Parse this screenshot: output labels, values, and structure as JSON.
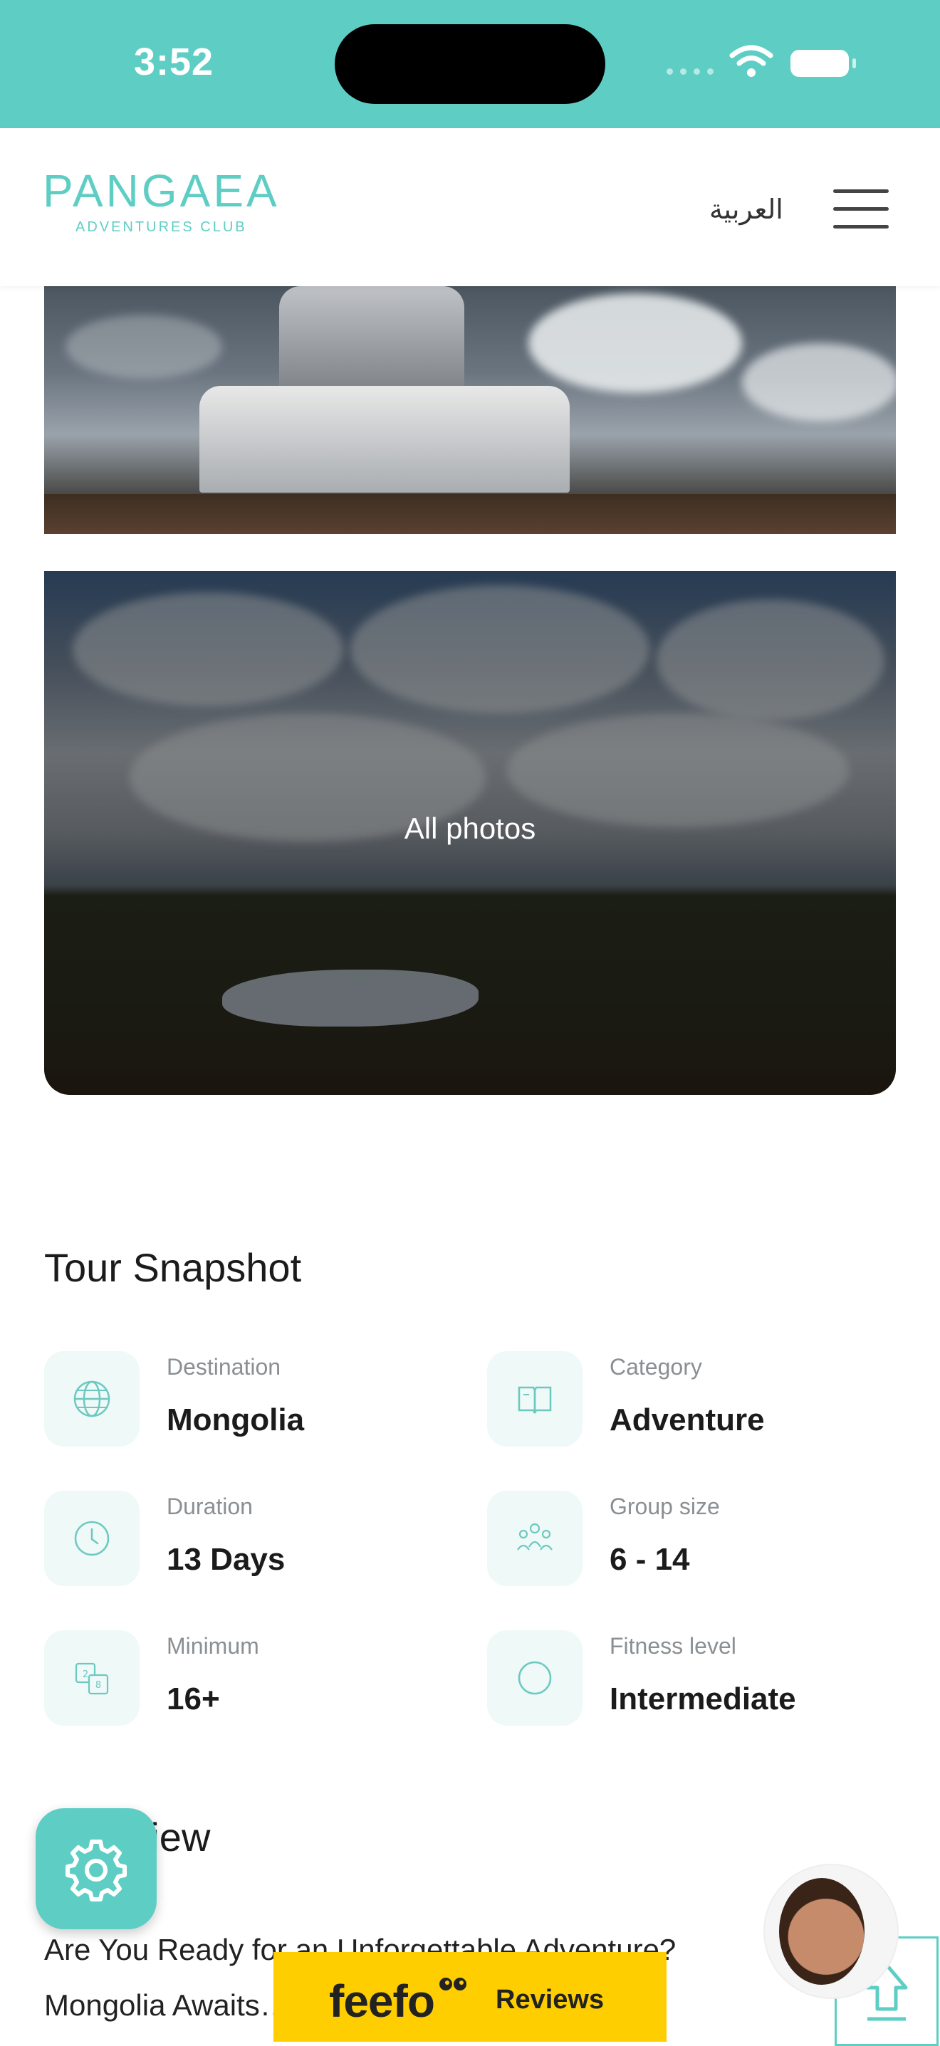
{
  "status_bar": {
    "time": "3:52"
  },
  "header": {
    "logo_text": "PANGAEA",
    "logo_subtext": "ADVENTURES CLUB",
    "language_link": "العربية"
  },
  "gallery": {
    "all_photos_label": "All photos"
  },
  "snapshot": {
    "title": "Tour Snapshot",
    "items": [
      {
        "label": "Destination",
        "value": "Mongolia",
        "icon": "globe-icon"
      },
      {
        "label": "Category",
        "value": "Adventure",
        "icon": "book-icon"
      },
      {
        "label": "Duration",
        "value": "13 Days",
        "icon": "clock-icon"
      },
      {
        "label": "Group size",
        "value": "6 - 14",
        "icon": "group-icon"
      },
      {
        "label": "Minimum",
        "value": "16+",
        "icon": "age-icon"
      },
      {
        "label": "Fitness level",
        "value": "Intermediate",
        "icon": "fitness-icon"
      }
    ]
  },
  "overview": {
    "title": "Overview",
    "line1": "Are You Ready for an Unforgettable Adventure?",
    "line2": "Mongolia Awaits… Journey across the vast"
  },
  "feefo": {
    "logo": "feefo",
    "reviews_label": "Reviews"
  },
  "colors": {
    "accent": "#5ecec4",
    "feefo_yellow": "#ffce00"
  }
}
